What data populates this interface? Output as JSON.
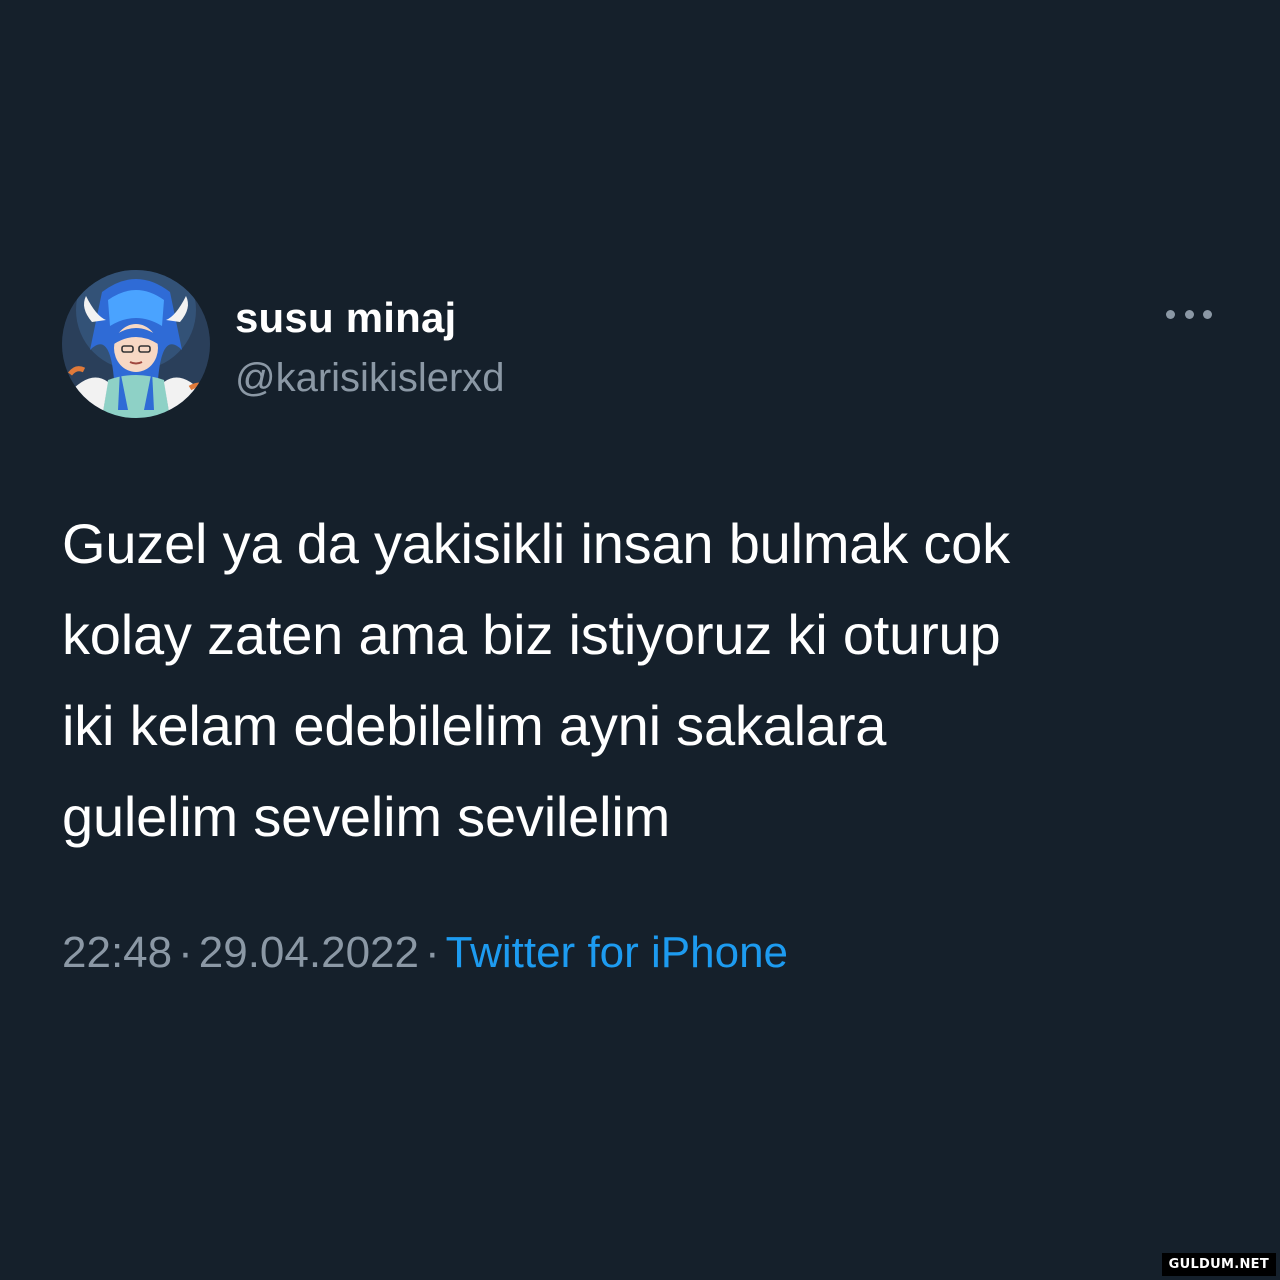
{
  "tweet": {
    "display_name": "susu minaj",
    "handle": "@karisikislerxd",
    "avatar_icon": "anime-avatar",
    "more_icon": "more-options-icon",
    "text": "Guzel ya da yakisikli insan bulmak cok\nkolay zaten ama biz istiyoruz ki oturup\niki kelam edebilelim ayni sakalara\ngulelim sevelim sevilelim",
    "time": "22:48",
    "separator": "·",
    "date": "29.04.2022",
    "source": "Twitter for iPhone"
  },
  "watermark": "GULDUM.NET",
  "colors": {
    "background": "#15202b",
    "text": "#ffffff",
    "muted": "#8b98a5",
    "accent": "#1d9bf0"
  }
}
